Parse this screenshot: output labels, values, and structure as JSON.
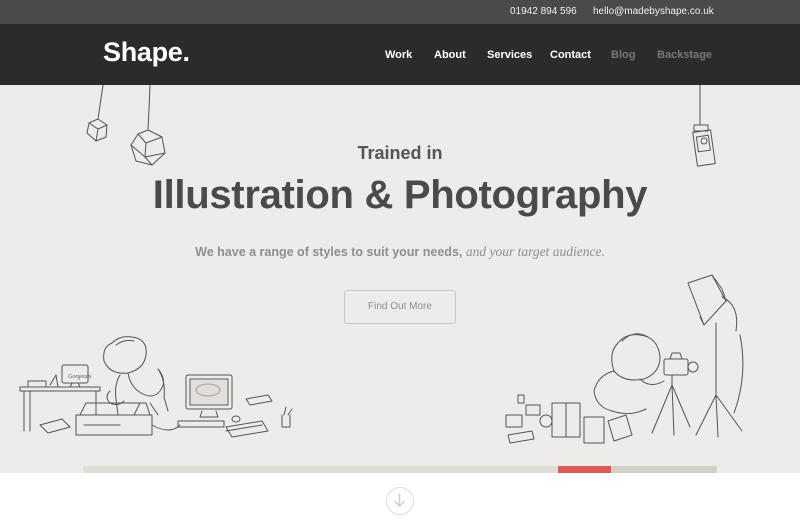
{
  "topbar": {
    "phone": "01942 894 596",
    "email": "hello@madebyshape.co.uk"
  },
  "brand": {
    "logo": "Shape."
  },
  "nav": {
    "work": "Work",
    "about": "About",
    "services": "Services",
    "contact": "Contact",
    "blog": "Blog",
    "backstage": "Backstage"
  },
  "hero": {
    "subtitle": "Trained in",
    "title": "Illustration & Photography",
    "tagline_main": "We have a range of styles to suit your needs,",
    "tagline_italic": "and your target audience.",
    "cta": "Find Out More"
  },
  "illustration": {
    "monitor_text": "Gorgeous"
  },
  "slider": {
    "active_slide_color": "#e05a55",
    "track_color": "#e0ddd6"
  },
  "icons": {
    "scroll_down": "arrow-down-circle-icon"
  }
}
